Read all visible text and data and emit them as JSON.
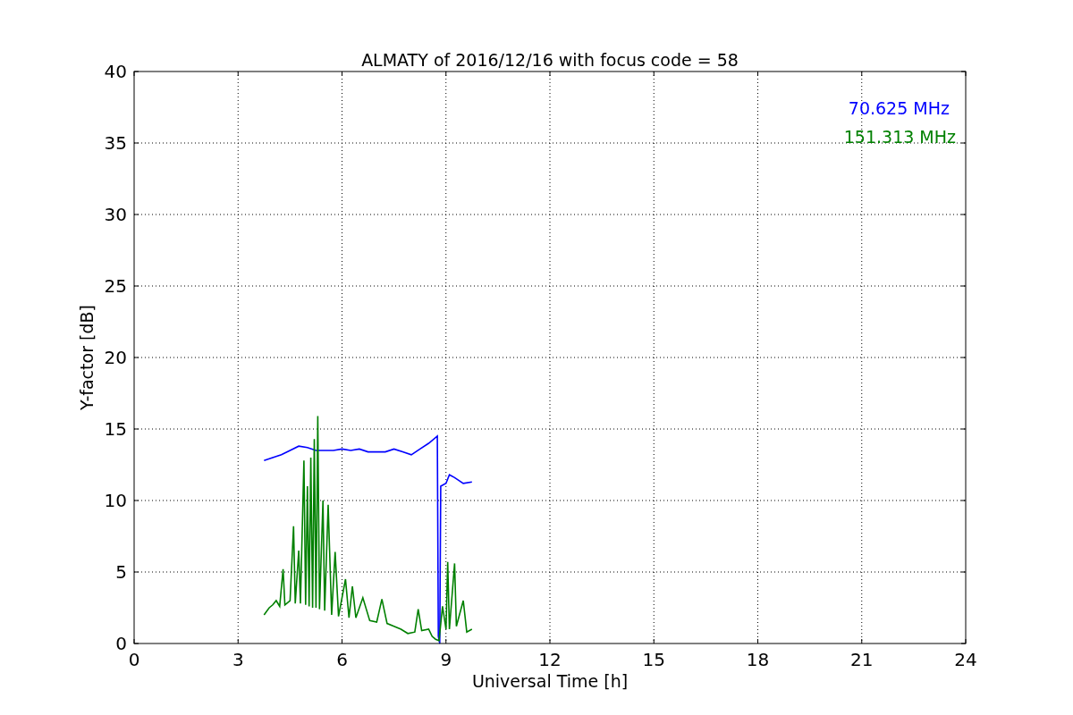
{
  "chart_data": {
    "type": "line",
    "title": "ALMATY of 2016/12/16 with focus code = 58",
    "xlabel": "Universal Time [h]",
    "ylabel": "Y-factor [dB]",
    "xlim": [
      0,
      24
    ],
    "ylim": [
      0,
      40
    ],
    "xticks": [
      0,
      3,
      6,
      9,
      12,
      15,
      18,
      21,
      24
    ],
    "yticks": [
      0,
      5,
      10,
      15,
      20,
      25,
      30,
      35,
      40
    ],
    "grid": true,
    "series": [
      {
        "name": "70.625 MHz",
        "color": "#0000ff",
        "x": [
          3.75,
          4.0,
          4.25,
          4.5,
          4.75,
          5.0,
          5.25,
          5.5,
          5.75,
          6.0,
          6.25,
          6.5,
          6.75,
          7.0,
          7.25,
          7.5,
          7.75,
          8.0,
          8.25,
          8.5,
          8.75,
          8.78,
          8.82,
          8.85,
          9.0,
          9.1,
          9.25,
          9.5,
          9.75
        ],
        "values": [
          12.8,
          13.0,
          13.2,
          13.5,
          13.8,
          13.7,
          13.5,
          13.5,
          13.5,
          13.6,
          13.5,
          13.6,
          13.4,
          13.4,
          13.4,
          13.6,
          13.4,
          13.2,
          13.6,
          14.0,
          14.5,
          0.5,
          0.0,
          11.0,
          11.2,
          11.8,
          11.6,
          11.2,
          11.3
        ]
      },
      {
        "name": "151.313 MHz",
        "color": "#008000",
        "x": [
          3.75,
          3.9,
          4.0,
          4.1,
          4.2,
          4.3,
          4.35,
          4.5,
          4.6,
          4.65,
          4.75,
          4.8,
          4.9,
          4.95,
          5.0,
          5.05,
          5.1,
          5.15,
          5.2,
          5.25,
          5.3,
          5.35,
          5.45,
          5.5,
          5.6,
          5.7,
          5.8,
          5.9,
          6.1,
          6.2,
          6.3,
          6.4,
          6.6,
          6.8,
          7.0,
          7.15,
          7.3,
          7.5,
          7.7,
          7.9,
          8.1,
          8.2,
          8.3,
          8.5,
          8.6,
          8.7,
          8.8,
          8.9,
          9.0,
          9.05,
          9.1,
          9.25,
          9.3,
          9.5,
          9.6,
          9.75
        ],
        "values": [
          2.0,
          2.5,
          2.7,
          3.0,
          2.6,
          5.2,
          2.7,
          3.0,
          8.2,
          2.8,
          6.5,
          2.8,
          12.8,
          2.7,
          11.0,
          2.6,
          13.0,
          2.5,
          14.3,
          2.5,
          15.9,
          2.4,
          10.0,
          2.3,
          9.7,
          2.0,
          6.4,
          1.9,
          4.5,
          1.8,
          4.0,
          1.8,
          3.2,
          1.6,
          1.5,
          3.1,
          1.4,
          1.2,
          1.0,
          0.7,
          0.8,
          2.4,
          0.9,
          1.0,
          0.5,
          0.3,
          0.2,
          2.6,
          1.0,
          5.7,
          1.0,
          5.6,
          1.2,
          3.0,
          0.8,
          1.0
        ]
      }
    ]
  }
}
